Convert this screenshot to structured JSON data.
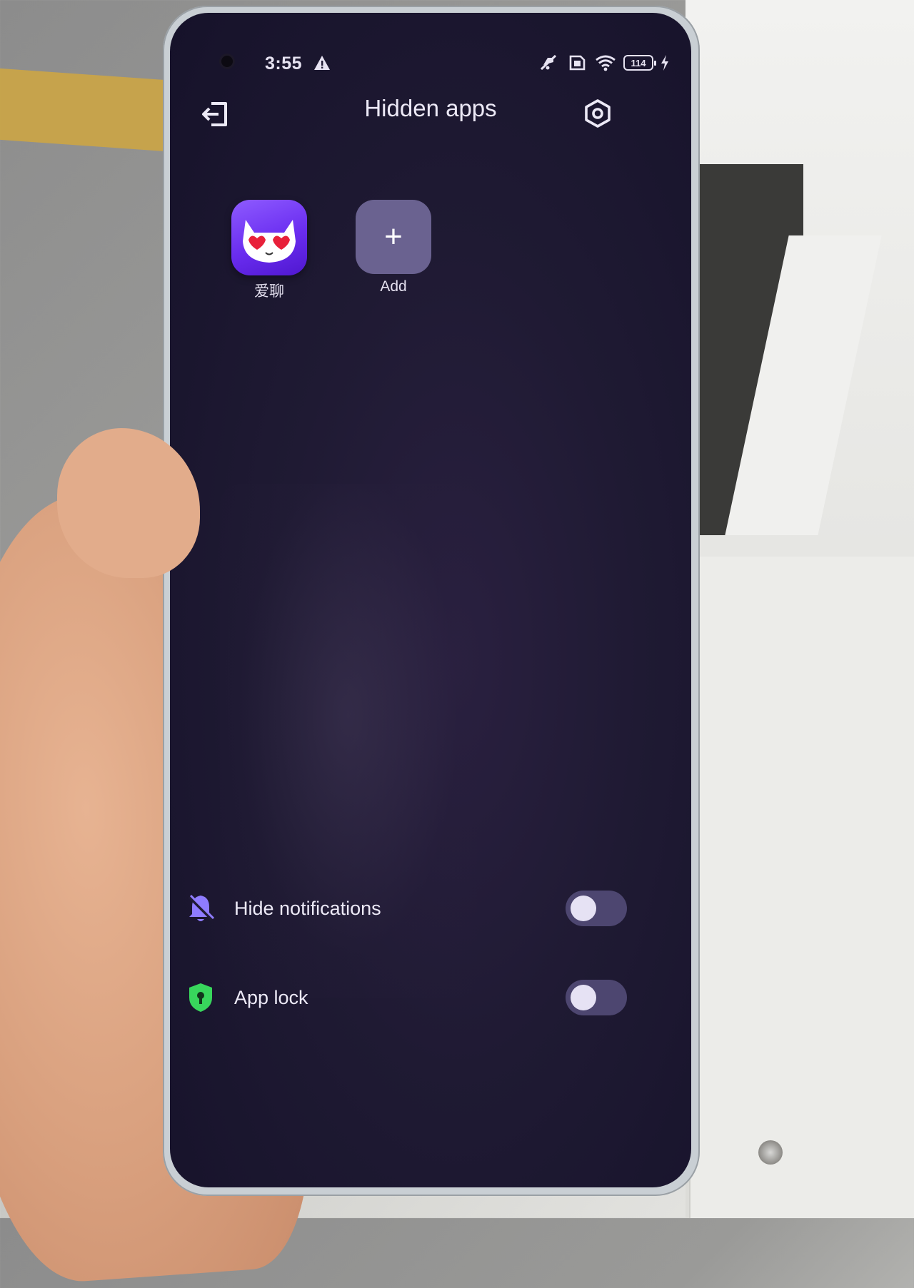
{
  "status_bar": {
    "time": "3:55",
    "alert_icon": "warning-triangle-icon",
    "icons": [
      "mute-icon",
      "sim-icon",
      "wifi-icon"
    ],
    "battery_level": "114",
    "charging_icon": "charging-bolt-icon"
  },
  "header": {
    "title": "Hidden apps",
    "back_icon": "exit-icon",
    "settings_icon": "settings-hex-icon"
  },
  "apps": [
    {
      "label": "爱聊",
      "icon": "cat-heart-eyes-app-icon"
    },
    {
      "label": "Add",
      "icon": "plus-icon",
      "symbol": "+"
    }
  ],
  "settings": {
    "hide_notifications": {
      "label": "Hide notifications",
      "icon": "bell-off-icon",
      "enabled": false
    },
    "app_lock": {
      "label": "App lock",
      "icon": "shield-lock-icon",
      "enabled": false
    }
  },
  "colors": {
    "screen_bg": "#1f1a33",
    "text": "#ece9f6",
    "app_tile": "#6a2df0",
    "add_tile": "#6a6290",
    "toggle_track": "#4d4670",
    "bell_icon": "#8f7cff",
    "shield_icon": "#38d65c"
  }
}
